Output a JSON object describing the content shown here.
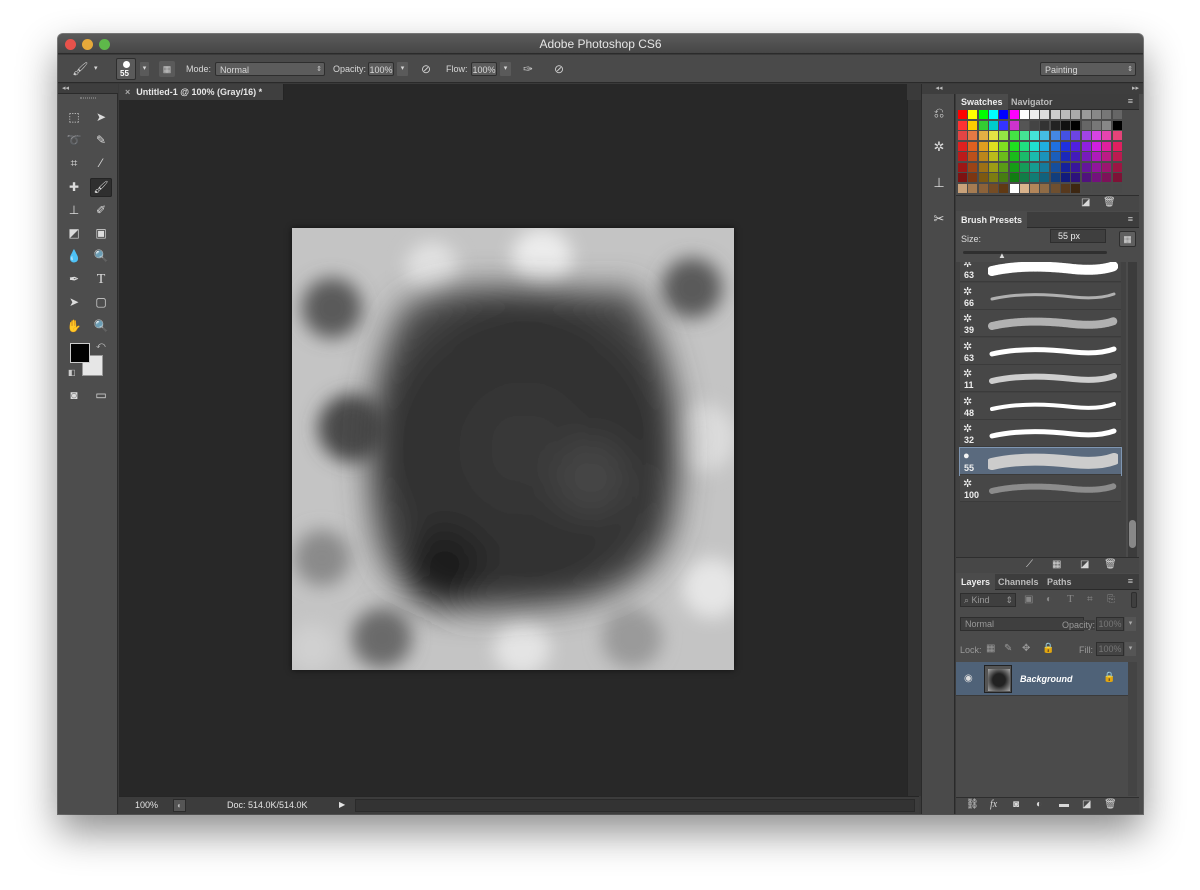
{
  "window": {
    "title": "Adobe Photoshop CS6"
  },
  "options": {
    "brush_size": "55",
    "mode_label": "Mode:",
    "mode_value": "Normal",
    "opacity_label": "Opacity:",
    "opacity_value": "100%",
    "flow_label": "Flow:",
    "flow_value": "100%",
    "workspace": "Painting"
  },
  "document": {
    "tab_title": "Untitled-1 @ 100% (Gray/16) *"
  },
  "status": {
    "zoom": "100%",
    "doc_size": "Doc: 514.0K/514.0K"
  },
  "swatches_panel": {
    "tabs": [
      "Swatches",
      "Navigator"
    ]
  },
  "brush_panel": {
    "tab": "Brush Presets",
    "size_label": "Size:",
    "size_value": "55 px",
    "presets": [
      "63",
      "66",
      "39",
      "63",
      "11",
      "48",
      "32",
      "55",
      "100"
    ],
    "selected": "55"
  },
  "layers_panel": {
    "tabs": [
      "Layers",
      "Channels",
      "Paths"
    ],
    "filter": "Kind",
    "blend_mode": "Normal",
    "opacity_label": "Opacity:",
    "opacity_value": "100%",
    "lock_label": "Lock:",
    "fill_label": "Fill:",
    "fill_value": "100%",
    "layer_name": "Background"
  },
  "colors": {
    "foreground": "#000000",
    "background": "#e6e6e6",
    "selection": "#4f6278"
  }
}
